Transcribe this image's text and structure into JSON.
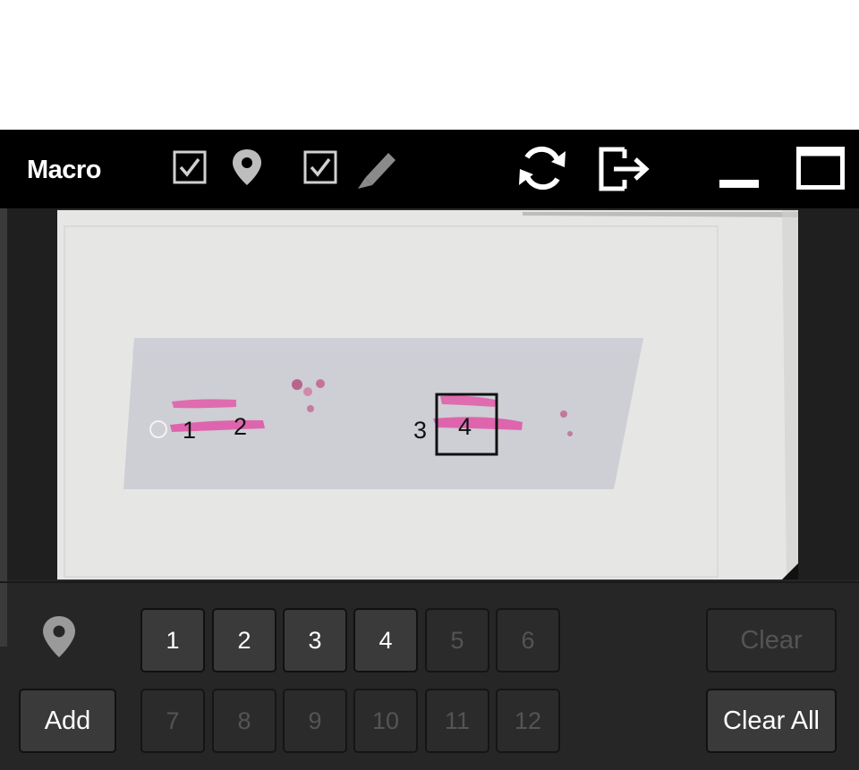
{
  "titlebar": {
    "title": "Macro",
    "show_markers_checked": true,
    "show_annotations_checked": true,
    "icons": [
      "checkbox-checked",
      "map-pin",
      "checkbox-checked",
      "pencil",
      "refresh",
      "export",
      "minimize",
      "maximize"
    ]
  },
  "slide": {
    "markers": [
      "1",
      "2",
      "3",
      "4"
    ],
    "selected_marker": "4"
  },
  "controls": {
    "pin_icon": "map-pin",
    "add_label": "Add",
    "clear_label": "Clear",
    "clear_all_label": "Clear All",
    "slots": [
      {
        "label": "1",
        "enabled": true
      },
      {
        "label": "2",
        "enabled": true
      },
      {
        "label": "3",
        "enabled": true
      },
      {
        "label": "4",
        "enabled": true
      },
      {
        "label": "5",
        "enabled": false
      },
      {
        "label": "6",
        "enabled": false
      },
      {
        "label": "7",
        "enabled": false
      },
      {
        "label": "8",
        "enabled": false
      },
      {
        "label": "9",
        "enabled": false
      },
      {
        "label": "10",
        "enabled": false
      },
      {
        "label": "11",
        "enabled": false
      },
      {
        "label": "12",
        "enabled": false
      }
    ]
  },
  "colors": {
    "panel_bg": "#262626",
    "titlebar_bg": "#000000",
    "button_enabled": "#3a3a3a",
    "button_disabled": "#2b2b2b",
    "tissue_pink": "#e05aa8"
  }
}
